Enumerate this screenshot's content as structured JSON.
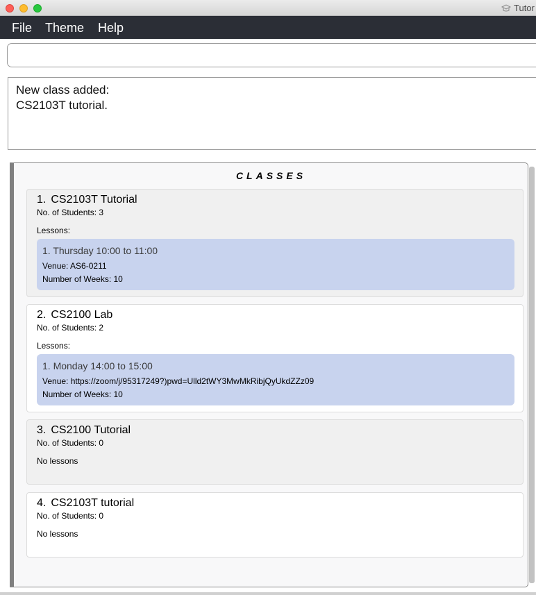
{
  "window": {
    "title": "Tutor"
  },
  "menu": {
    "file": "File",
    "theme": "Theme",
    "help": "Help"
  },
  "command": {
    "value": "",
    "placeholder": ""
  },
  "result": {
    "line1": "New class added:",
    "line2": "CS2103T tutorial."
  },
  "panel": {
    "header": "CLASSES",
    "classes": [
      {
        "index": "1.",
        "name": "CS2103T Tutorial",
        "students": "No. of Students:  3",
        "lessons_label": "Lessons:",
        "lesson": {
          "time": "1. Thursday 10:00 to 11:00",
          "venue": "Venue: AS6-0211",
          "weeks": "Number of Weeks: 10"
        }
      },
      {
        "index": "2.",
        "name": "CS2100 Lab",
        "students": "No. of Students:  2",
        "lessons_label": "Lessons:",
        "lesson": {
          "time": "1. Monday 14:00 to 15:00",
          "venue": "Venue: https://zoom/j/95317249?)pwd=Ulld2tWY3MwMkRibjQyUkdZZz09",
          "weeks": "Number of Weeks: 10"
        }
      },
      {
        "index": "3.",
        "name": "CS2100 Tutorial",
        "students": "No. of Students:  0",
        "lessons_label": "No lessons"
      },
      {
        "index": "4.",
        "name": "CS2103T tutorial",
        "students": "No. of Students:  0",
        "lessons_label": "No lessons"
      }
    ]
  },
  "colors": {
    "menubar": "#2b2e36",
    "lesson_bg": "#c8d3ee",
    "card_odd": "#f0f0f0",
    "card_even": "#ffffff"
  }
}
